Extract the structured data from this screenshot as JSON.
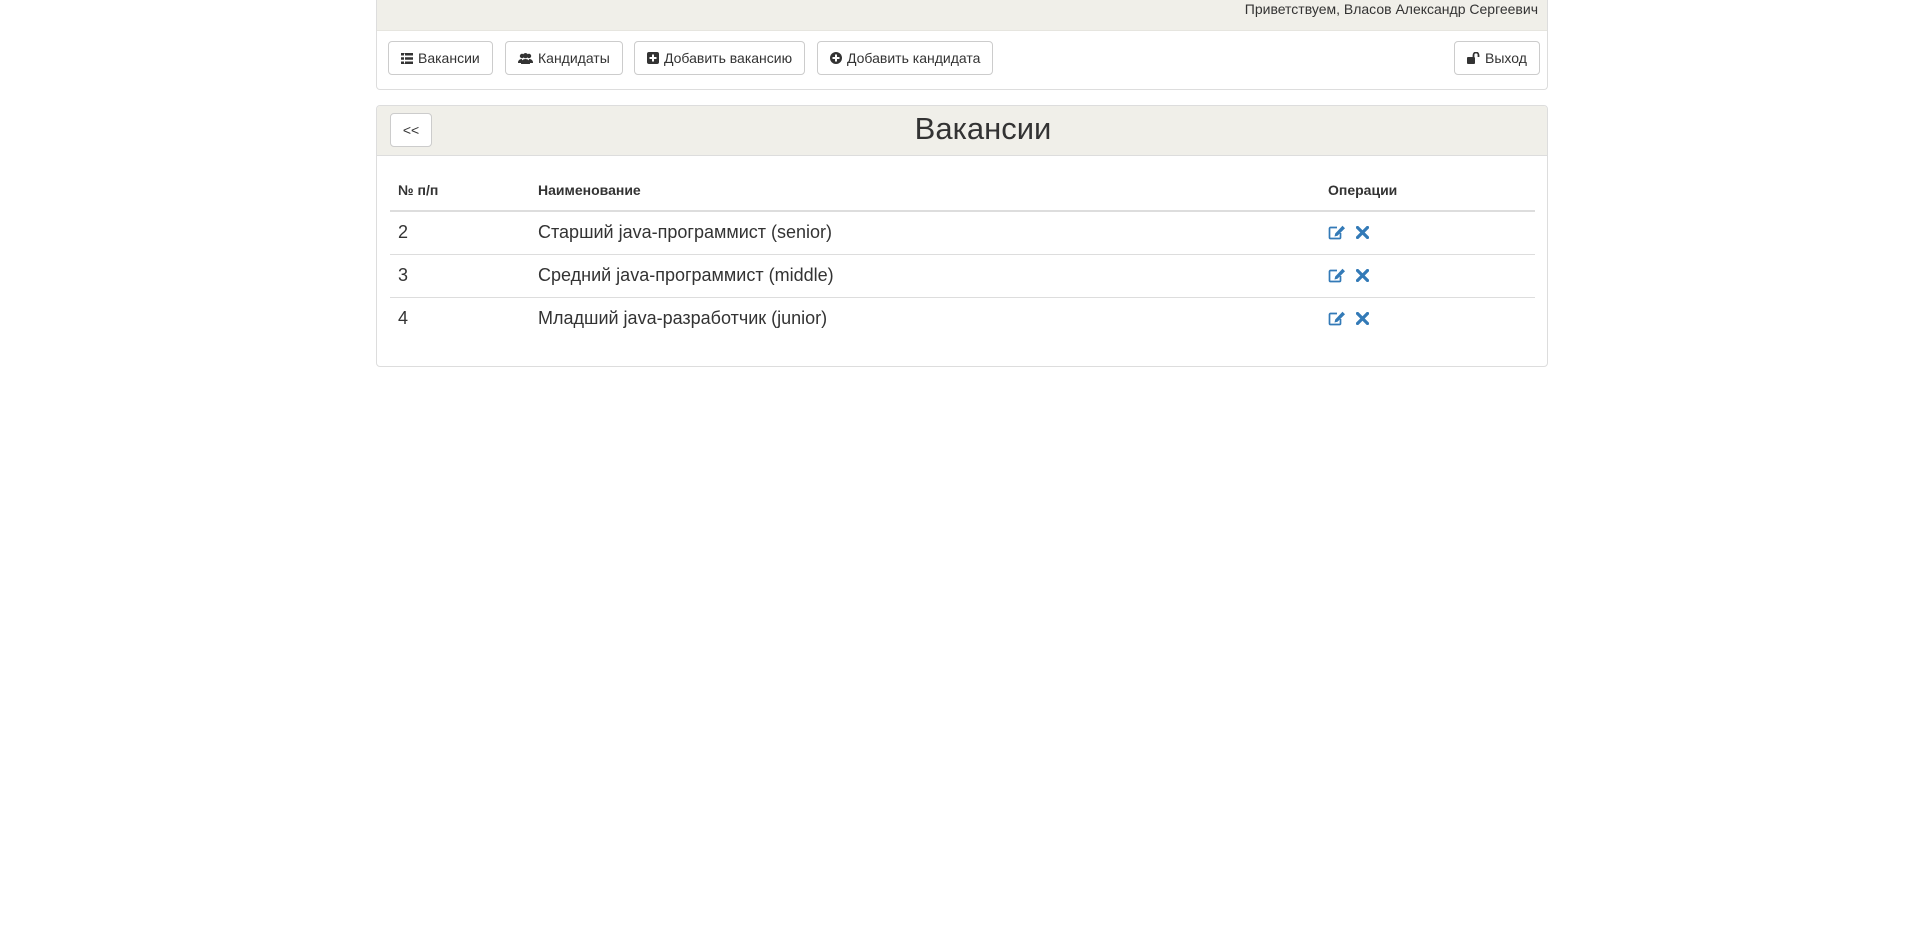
{
  "header": {
    "greeting": "Приветствуем, Власов Александр Сергеевич"
  },
  "nav": {
    "vacancies_label": "Вакансии",
    "candidates_label": "Кандидаты",
    "add_vacancy_label": "Добавить вакансию",
    "add_candidate_label": "Добавить кандидата",
    "logout_label": "Выход"
  },
  "vacancies_panel": {
    "back_label": "<<",
    "title": "Вакансии",
    "columns": [
      "№ п/п",
      "Наименование",
      "Операции"
    ],
    "rows": [
      {
        "num": "2",
        "name": "Старший java-программист (senior)"
      },
      {
        "num": "3",
        "name": "Средний java-программист (middle)"
      },
      {
        "num": "4",
        "name": "Младший java-разработчик (junior)"
      }
    ]
  },
  "colors": {
    "panel_heading_bg": "#f0efe9",
    "action_icon": "#337ab7"
  },
  "icons": {
    "vacancies": "list-icon",
    "candidates": "users-icon",
    "add_vacancy": "plus-square-icon",
    "add_candidate": "plus-circle-icon",
    "logout": "unlock-icon",
    "edit": "edit-icon",
    "delete": "close-icon"
  }
}
